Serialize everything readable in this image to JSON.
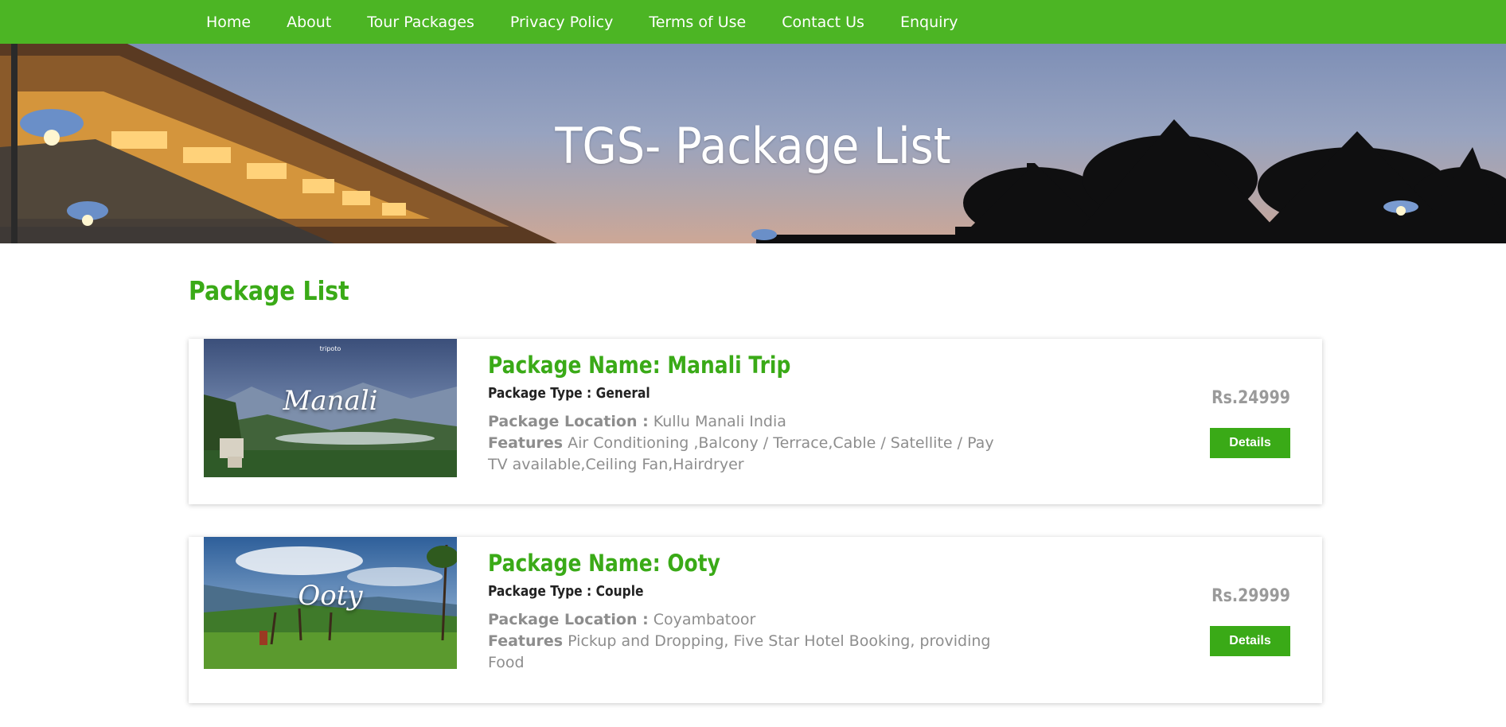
{
  "nav": {
    "items": [
      "Home",
      "About",
      "Tour Packages",
      "Privacy Policy",
      "Terms of Use",
      "Contact Us",
      "Enquiry"
    ]
  },
  "hero": {
    "title": "TGS- Package List"
  },
  "section": {
    "title": "Package List"
  },
  "packages": [
    {
      "thumb_brand": "tripoto",
      "thumb_label": "Manali",
      "name": "Package Name: Manali Trip",
      "type": "Package Type : General",
      "location_label": "Package Location :",
      "location": "Kullu Manali India",
      "features_label": "Features",
      "features": "Air Conditioning ,Balcony / Terrace,Cable / Satellite / Pay TV available,Ceiling Fan,Hairdryer",
      "price": "Rs.24999",
      "button": "Details"
    },
    {
      "thumb_label": "Ooty",
      "name": "Package Name: Ooty",
      "type": "Package Type : Couple",
      "location_label": "Package Location :",
      "location": "Coyambatoor",
      "features_label": "Features",
      "features": "Pickup and Dropping, Five Star Hotel Booking, providing Food",
      "price": "Rs.29999",
      "button": "Details"
    }
  ],
  "colors": {
    "brand_green": "#4cb524",
    "title_green": "#3aaa17"
  }
}
